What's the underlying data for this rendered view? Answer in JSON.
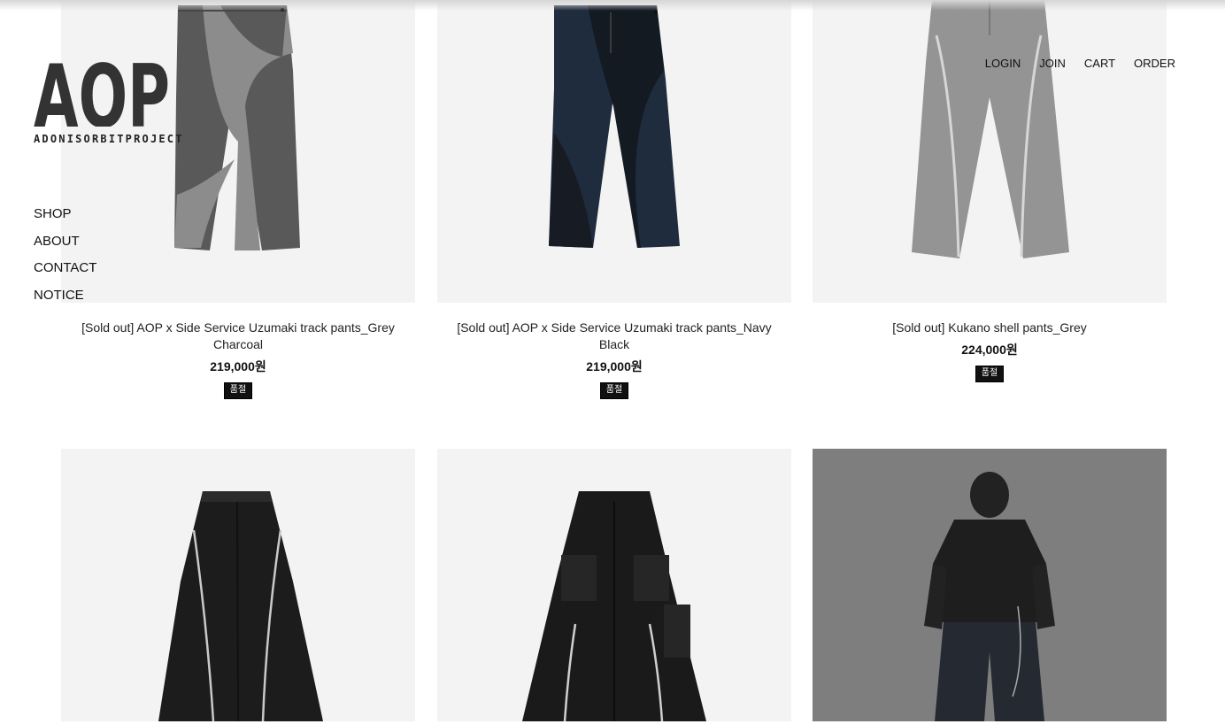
{
  "brand": {
    "logo_text": "AOP",
    "subtitle": "ADONISORBITPROJECT"
  },
  "side_nav": {
    "items": [
      {
        "label": "SHOP"
      },
      {
        "label": "ABOUT"
      },
      {
        "label": "CONTACT"
      },
      {
        "label": "NOTICE"
      }
    ]
  },
  "top_nav": {
    "items": [
      {
        "label": "LOGIN"
      },
      {
        "label": "JOIN"
      },
      {
        "label": "CART"
      },
      {
        "label": "ORDER"
      }
    ]
  },
  "products": [
    {
      "name": "[Sold out] AOP x Side Service Uzumaki track pants_Grey Charcoal",
      "price": "219,000원",
      "badge": "품절",
      "image": "grey-charcoal-track-pants"
    },
    {
      "name": "[Sold out] AOP x Side Service Uzumaki track pants_Navy Black",
      "price": "219,000원",
      "badge": "품절",
      "image": "navy-black-track-pants"
    },
    {
      "name": "[Sold out] Kukano shell pants_Grey",
      "price": "224,000원",
      "badge": "품절",
      "image": "grey-shell-pants-zip"
    },
    {
      "image": "black-zip-pants"
    },
    {
      "image": "black-cargo-pants"
    },
    {
      "image": "model-leather-jacket"
    }
  ],
  "colors": {
    "image_bg": "#f3f3f3",
    "badge_bg": "#111111",
    "text": "#111111"
  }
}
